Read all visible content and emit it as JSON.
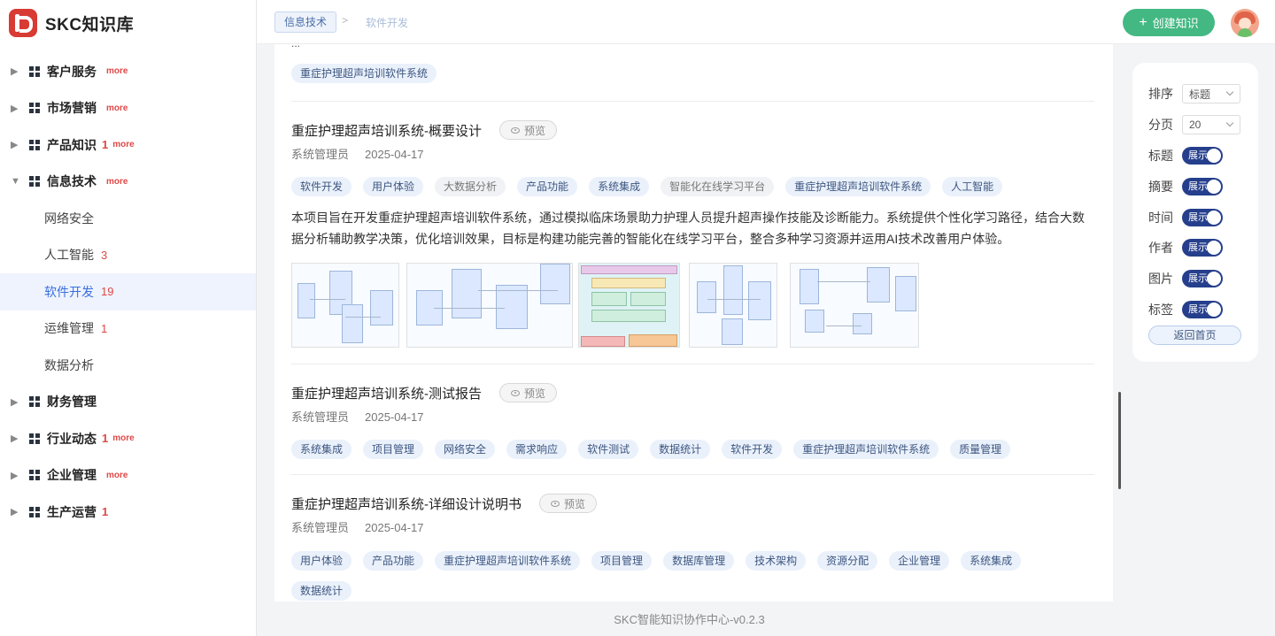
{
  "app": {
    "name": "SKC知识库"
  },
  "sidebar": {
    "items": [
      {
        "label": "客户服务",
        "count": "",
        "more": "more",
        "expanded": false
      },
      {
        "label": "市场营销",
        "count": "",
        "more": "more",
        "expanded": false
      },
      {
        "label": "产品知识",
        "count": "1",
        "more": "more",
        "expanded": false
      },
      {
        "label": "信息技术",
        "count": "",
        "more": "more",
        "expanded": true
      },
      {
        "label": "财务管理",
        "count": "",
        "more": "",
        "expanded": false
      },
      {
        "label": "行业动态",
        "count": "1",
        "more": "more",
        "expanded": false
      },
      {
        "label": "企业管理",
        "count": "",
        "more": "more",
        "expanded": false
      },
      {
        "label": "生产运营",
        "count": "1",
        "more": "",
        "expanded": false
      }
    ],
    "sub_items": [
      {
        "label": "网络安全",
        "count": ""
      },
      {
        "label": "人工智能",
        "count": "3"
      },
      {
        "label": "软件开发",
        "count": "19",
        "active": true
      },
      {
        "label": "运维管理",
        "count": "1"
      },
      {
        "label": "数据分析",
        "count": ""
      }
    ]
  },
  "header": {
    "breadcrumb_root": "信息技术",
    "breadcrumb_sep": ">",
    "breadcrumb_current": "软件开发",
    "create_label": "创建知识",
    "create_icon": "plus-icon"
  },
  "main": {
    "cut_text": "...",
    "top_tag": "重症护理超声培训软件系统",
    "articles": [
      {
        "title": "重症护理超声培训系统-概要设计",
        "preview": "预览",
        "author": "系统管理员",
        "date": "2025-04-17",
        "tags": [
          {
            "label": "软件开发",
            "muted": false
          },
          {
            "label": "用户体验",
            "muted": false
          },
          {
            "label": "大数据分析",
            "muted": true
          },
          {
            "label": "产品功能",
            "muted": false
          },
          {
            "label": "系统集成",
            "muted": false
          },
          {
            "label": "智能化在线学习平台",
            "muted": true
          },
          {
            "label": "重症护理超声培训软件系统",
            "muted": false
          },
          {
            "label": "人工智能",
            "muted": false
          }
        ],
        "summary": "本项目旨在开发重症护理超声培训软件系统，通过模拟临床场景助力护理人员提升超声操作技能及诊断能力。系统提供个性化学习路径，结合大数据分析辅助教学决策，优化培训效果，目标是构建功能完善的智能化在线学习平台，整合多种学习资源并运用AI技术改善用户体验。"
      },
      {
        "title": "重症护理超声培训系统-测试报告",
        "preview": "预览",
        "author": "系统管理员",
        "date": "2025-04-17",
        "tags": [
          {
            "label": "系统集成",
            "muted": false
          },
          {
            "label": "项目管理",
            "muted": false
          },
          {
            "label": "网络安全",
            "muted": false
          },
          {
            "label": "需求响应",
            "muted": false
          },
          {
            "label": "软件测试",
            "muted": false
          },
          {
            "label": "数据统计",
            "muted": false
          },
          {
            "label": "软件开发",
            "muted": false
          },
          {
            "label": "重症护理超声培训软件系统",
            "muted": false
          },
          {
            "label": "质量管理",
            "muted": false
          }
        ]
      },
      {
        "title": "重症护理超声培训系统-详细设计说明书",
        "preview": "预览",
        "author": "系统管理员",
        "date": "2025-04-17",
        "tags": [
          {
            "label": "用户体验",
            "muted": false
          },
          {
            "label": "产品功能",
            "muted": false
          },
          {
            "label": "重症护理超声培训软件系统",
            "muted": false
          },
          {
            "label": "项目管理",
            "muted": false
          },
          {
            "label": "数据库管理",
            "muted": false
          },
          {
            "label": "技术架构",
            "muted": false
          },
          {
            "label": "资源分配",
            "muted": false
          },
          {
            "label": "企业管理",
            "muted": false
          },
          {
            "label": "系统集成",
            "muted": false
          },
          {
            "label": "数据统计",
            "muted": false
          }
        ]
      }
    ]
  },
  "panel": {
    "sort_label": "排序",
    "sort_value": "标题",
    "page_label": "分页",
    "page_value": "20",
    "toggles": [
      {
        "label": "标题",
        "state": "展示"
      },
      {
        "label": "摘要",
        "state": "展示"
      },
      {
        "label": "时间",
        "state": "展示"
      },
      {
        "label": "作者",
        "state": "展示"
      },
      {
        "label": "图片",
        "state": "展示"
      },
      {
        "label": "标签",
        "state": "展示"
      }
    ],
    "home_label": "返回首页"
  },
  "footer": {
    "text": "SKC智能知识协作中心-v0.2.3"
  },
  "colors": {
    "accent": "#43b883",
    "toggle": "#253f8c",
    "danger": "#e04848",
    "active_bg": "#eef3fd"
  }
}
